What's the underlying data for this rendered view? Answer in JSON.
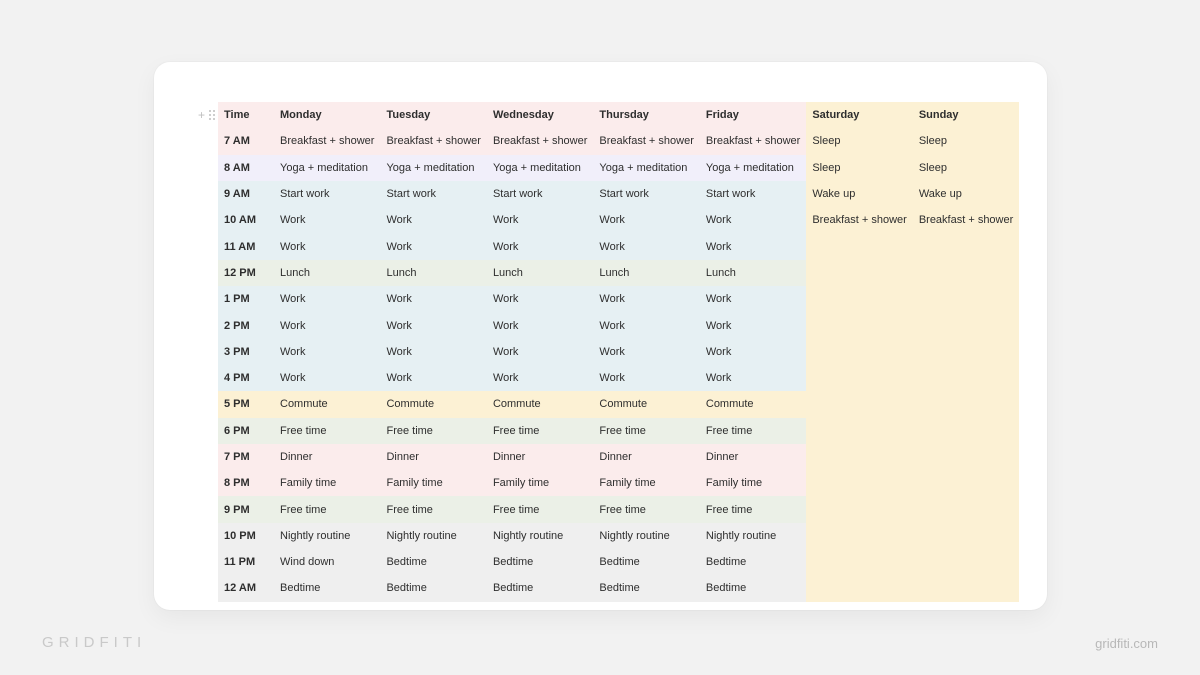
{
  "branding": {
    "logo_text": "GRIDFITI",
    "site_text": "gridfiti.com"
  },
  "schedule": {
    "headers": [
      "Time",
      "Monday",
      "Tuesday",
      "Wednesday",
      "Thursday",
      "Friday",
      "Saturday",
      "Sunday"
    ],
    "rows": [
      {
        "time": "7 AM",
        "tone": "pink",
        "mon": "Breakfast + shower",
        "tue": "Breakfast + shower",
        "wed": "Breakfast + shower",
        "thu": "Breakfast + shower",
        "fri": "Breakfast + shower",
        "sat": "Sleep",
        "sun": "Sleep"
      },
      {
        "time": "8 AM",
        "tone": "lav",
        "mon": "Yoga + meditation",
        "tue": "Yoga + meditation",
        "wed": "Yoga + meditation",
        "thu": "Yoga + meditation",
        "fri": "Yoga + meditation",
        "sat": "Sleep",
        "sun": "Sleep"
      },
      {
        "time": "9 AM",
        "tone": "blue",
        "mon": "Start work",
        "tue": "Start work",
        "wed": "Start work",
        "thu": "Start work",
        "fri": "Start work",
        "sat": "Wake up",
        "sun": "Wake up"
      },
      {
        "time": "10 AM",
        "tone": "blue",
        "mon": "Work",
        "tue": "Work",
        "wed": "Work",
        "thu": "Work",
        "fri": "Work",
        "sat": "Breakfast + shower",
        "sun": "Breakfast + shower"
      },
      {
        "time": "11 AM",
        "tone": "blue",
        "mon": "Work",
        "tue": "Work",
        "wed": "Work",
        "thu": "Work",
        "fri": "Work",
        "sat": "",
        "sun": ""
      },
      {
        "time": "12 PM",
        "tone": "sage",
        "mon": "Lunch",
        "tue": "Lunch",
        "wed": "Lunch",
        "thu": "Lunch",
        "fri": "Lunch",
        "sat": "",
        "sun": ""
      },
      {
        "time": "1 PM",
        "tone": "blue",
        "mon": "Work",
        "tue": "Work",
        "wed": "Work",
        "thu": "Work",
        "fri": "Work",
        "sat": "",
        "sun": ""
      },
      {
        "time": "2 PM",
        "tone": "blue",
        "mon": "Work",
        "tue": "Work",
        "wed": "Work",
        "thu": "Work",
        "fri": "Work",
        "sat": "",
        "sun": ""
      },
      {
        "time": "3 PM",
        "tone": "blue",
        "mon": "Work",
        "tue": "Work",
        "wed": "Work",
        "thu": "Work",
        "fri": "Work",
        "sat": "",
        "sun": ""
      },
      {
        "time": "4 PM",
        "tone": "blue",
        "mon": "Work",
        "tue": "Work",
        "wed": "Work",
        "thu": "Work",
        "fri": "Work",
        "sat": "",
        "sun": ""
      },
      {
        "time": "5 PM",
        "tone": "cream",
        "mon": "Commute",
        "tue": "Commute",
        "wed": "Commute",
        "thu": "Commute",
        "fri": "Commute",
        "sat": "",
        "sun": ""
      },
      {
        "time": "6 PM",
        "tone": "sage",
        "mon": "Free time",
        "tue": "Free time",
        "wed": "Free time",
        "thu": "Free time",
        "fri": "Free time",
        "sat": "",
        "sun": ""
      },
      {
        "time": "7 PM",
        "tone": "pink",
        "mon": "Dinner",
        "tue": "Dinner",
        "wed": "Dinner",
        "thu": "Dinner",
        "fri": "Dinner",
        "sat": "",
        "sun": ""
      },
      {
        "time": "8 PM",
        "tone": "pink",
        "mon": "Family time",
        "tue": "Family time",
        "wed": "Family time",
        "thu": "Family time",
        "fri": "Family time",
        "sat": "",
        "sun": ""
      },
      {
        "time": "9 PM",
        "tone": "sage",
        "mon": "Free time",
        "tue": "Free time",
        "wed": "Free time",
        "thu": "Free time",
        "fri": "Free time",
        "sat": "",
        "sun": ""
      },
      {
        "time": "10 PM",
        "tone": "grey",
        "mon": "Nightly routine",
        "tue": "Nightly routine",
        "wed": "Nightly routine",
        "thu": "Nightly routine",
        "fri": "Nightly routine",
        "sat": "",
        "sun": ""
      },
      {
        "time": "11 PM",
        "tone": "grey",
        "mon": "Wind down",
        "tue": "Bedtime",
        "wed": "Bedtime",
        "thu": "Bedtime",
        "fri": "Bedtime",
        "sat": "",
        "sun": ""
      },
      {
        "time": "12 AM",
        "tone": "grey",
        "mon": "Bedtime",
        "tue": "Bedtime",
        "wed": "Bedtime",
        "thu": "Bedtime",
        "fri": "Bedtime",
        "sat": "",
        "sun": ""
      }
    ]
  }
}
